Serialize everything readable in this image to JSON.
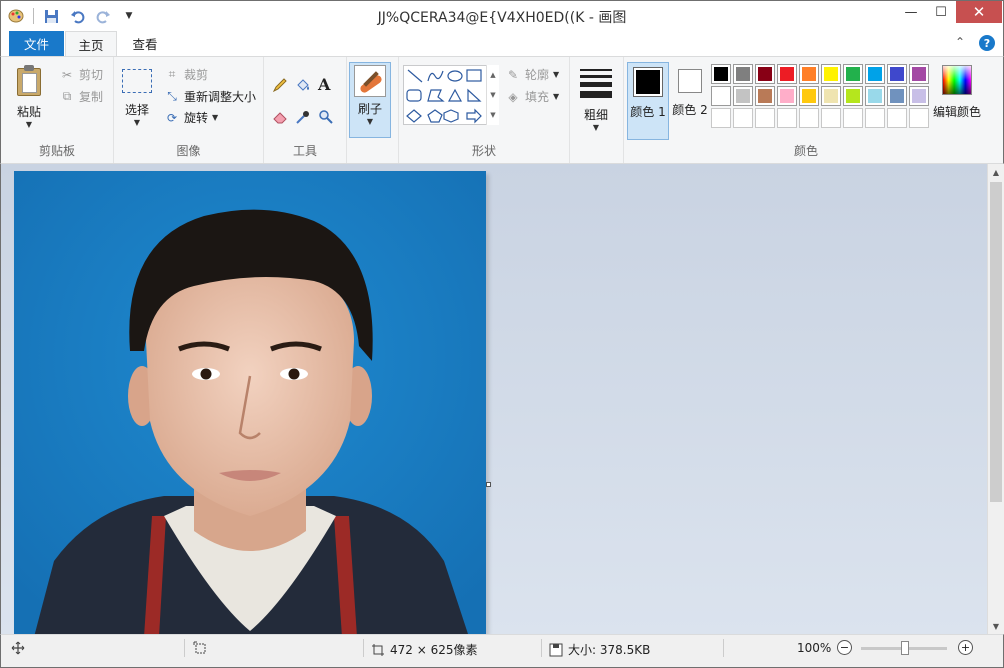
{
  "window": {
    "title": "JJ%QCERA34@E{V4XH0ED((K - 画图",
    "minimize": "—",
    "maximize": "☐",
    "close": "✕"
  },
  "qat": {
    "app_icon": "paint-app-icon",
    "save_icon": "save-icon",
    "undo_icon": "undo-icon",
    "redo_icon": "redo-icon",
    "customize_icon": "chevron-down-icon"
  },
  "tabs": {
    "file": "文件",
    "home": "主页",
    "view": "查看",
    "collapse": "⌃",
    "help": "?"
  },
  "ribbon": {
    "clipboard": {
      "label": "剪贴板",
      "paste": "粘贴",
      "cut": "剪切",
      "copy": "复制"
    },
    "image": {
      "label": "图像",
      "select": "选择",
      "crop": "裁剪",
      "resize": "重新调整大小",
      "rotate": "旋转"
    },
    "tools": {
      "label": "工具",
      "items": [
        "pencil-icon",
        "fill-icon",
        "text-icon",
        "eraser-icon",
        "color-picker-icon",
        "magnifier-icon"
      ]
    },
    "brushes": {
      "label": "刷子"
    },
    "shapes": {
      "label": "形状",
      "outline": "轮廓",
      "fill": "填充"
    },
    "size": {
      "label": "粗细"
    },
    "colors": {
      "label": "颜色",
      "color1": "颜色 1",
      "color2": "颜色 2",
      "edit_colors": "编辑颜色",
      "color1_value": "#000000",
      "color2_value": "#ffffff",
      "palette_row1": [
        "#000000",
        "#7f7f7f",
        "#880015",
        "#ed1c24",
        "#ff7f27",
        "#fff200",
        "#22b14c",
        "#00a2e8",
        "#3f48cc",
        "#a349a4"
      ],
      "palette_row2": [
        "#ffffff",
        "#c3c3c3",
        "#b97a57",
        "#ffaec9",
        "#ffc90e",
        "#efe4b0",
        "#b5e61d",
        "#99d9ea",
        "#7092be",
        "#c8bfe7"
      ]
    }
  },
  "canvas": {
    "background": "#1a7dc4"
  },
  "status": {
    "dimensions": "472 × 625像素",
    "size": "大小: 378.5KB",
    "zoom": "100%",
    "zoom_level": 1.0
  }
}
